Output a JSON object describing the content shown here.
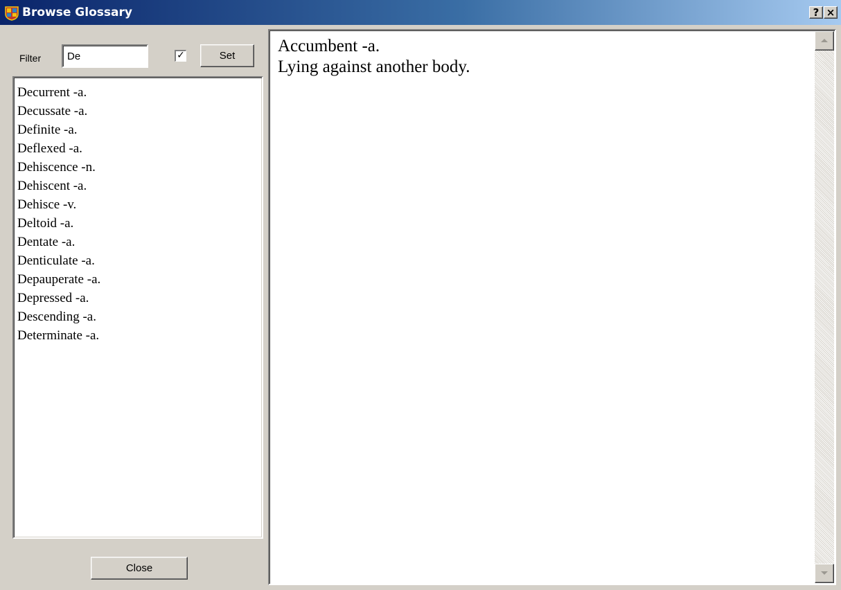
{
  "window": {
    "title": "Browse Glossary",
    "help_button": "?",
    "close_button": "×"
  },
  "filter": {
    "label": "Filter",
    "value": "De",
    "checkbox_checked": true,
    "set_label": "Set"
  },
  "terms": [
    "Decurrent -a.",
    "Decussate -a.",
    "Definite -a.",
    "Deflexed -a.",
    "Dehiscence -n.",
    "Dehiscent -a.",
    "Dehisce -v.",
    "Deltoid -a.",
    "Dentate -a.",
    "Denticulate -a.",
    "Depauperate -a.",
    "Depressed -a.",
    "Descending -a.",
    "Determinate -a."
  ],
  "definition": {
    "term": "Accumbent -a.",
    "text": "Lying against another body."
  },
  "footer": {
    "close_label": "Close"
  },
  "icons": {
    "app": "crest-icon",
    "scroll_up": "scroll-up-arrow-icon",
    "scroll_down": "scroll-down-arrow-icon"
  }
}
